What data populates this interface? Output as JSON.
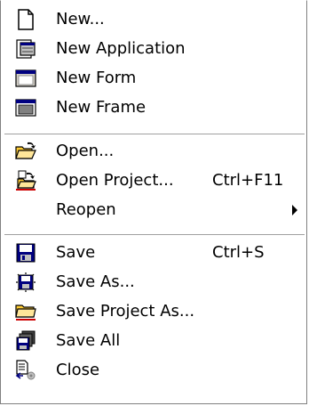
{
  "menu": {
    "items": [
      {
        "label": "New...",
        "icon": "new-document-icon"
      },
      {
        "label": "New Application",
        "icon": "new-application-icon"
      },
      {
        "label": "New Form",
        "icon": "new-form-icon"
      },
      {
        "label": "New Frame",
        "icon": "new-frame-icon"
      },
      {
        "label": "Open...",
        "icon": "open-folder-icon"
      },
      {
        "label": "Open Project...",
        "shortcut": "Ctrl+F11",
        "icon": "open-project-icon"
      },
      {
        "label": "Reopen",
        "submenu": true
      },
      {
        "label": "Save",
        "shortcut": "Ctrl+S",
        "icon": "save-disk-icon"
      },
      {
        "label": "Save As...",
        "icon": "save-as-icon"
      },
      {
        "label": "Save Project As...",
        "icon": "save-project-as-icon"
      },
      {
        "label": "Save All",
        "icon": "save-all-icon"
      },
      {
        "label": "Close",
        "icon": "close-document-icon"
      }
    ]
  },
  "colors": {
    "text": "#000000",
    "separator": "#a0a0a0",
    "disk_blue": "#000080",
    "folder_yellow": "#ffcc33"
  }
}
